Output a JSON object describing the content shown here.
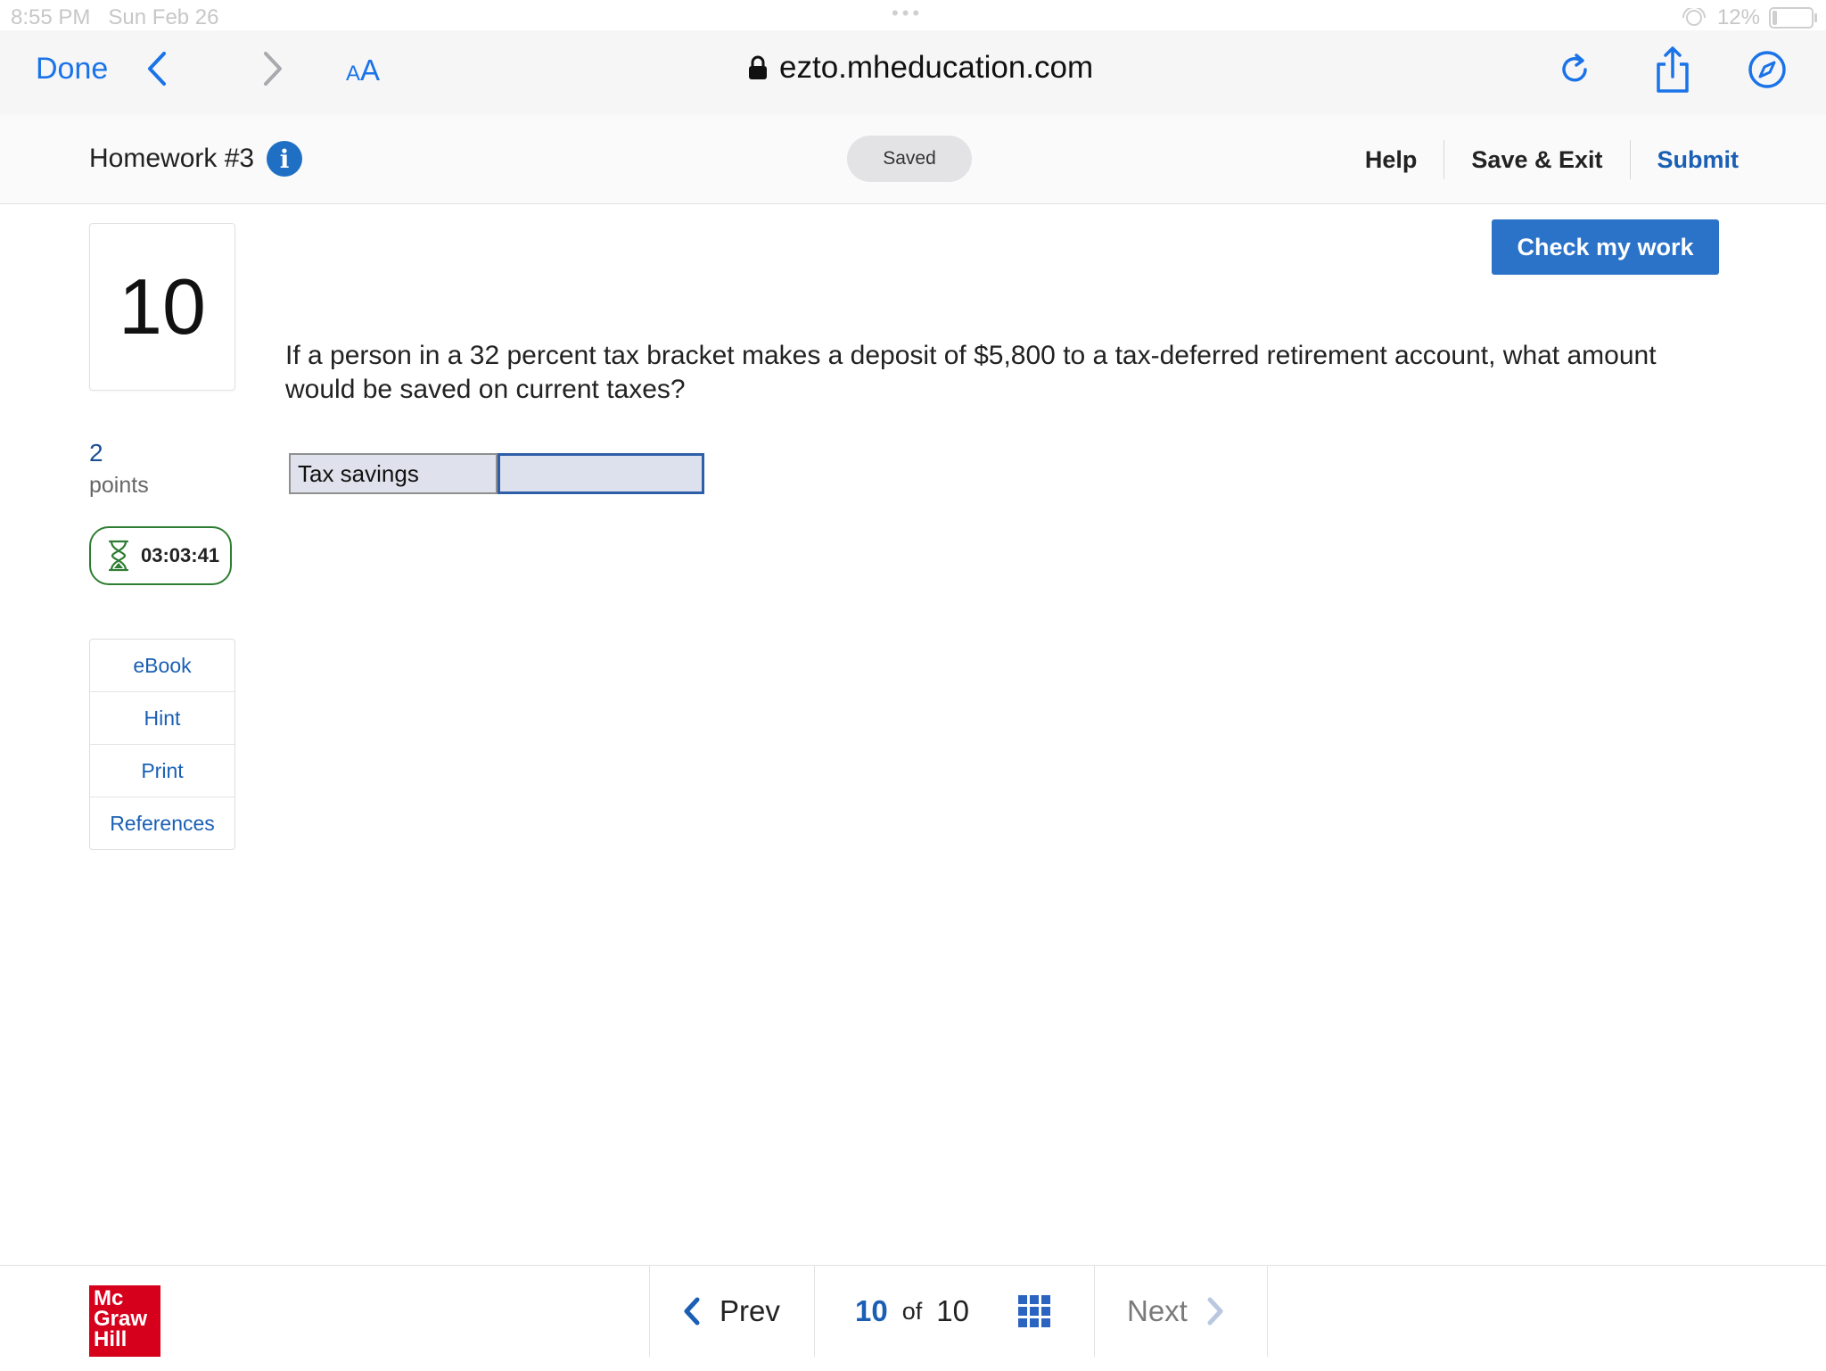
{
  "status_bar": {
    "time": "8:55 PM",
    "date": "Sun Feb 26",
    "battery": "12%"
  },
  "browser": {
    "done_label": "Done",
    "text_size_small": "A",
    "text_size_large": "A",
    "url": "ezto.mheducation.com"
  },
  "header": {
    "assignment_title": "Homework #3",
    "info_icon": "i",
    "save_status": "Saved",
    "help_label": "Help",
    "save_exit_label": "Save & Exit",
    "submit_label": "Submit"
  },
  "check_button_label": "Check my work",
  "sidebar": {
    "question_number": "10",
    "points_value": "2",
    "points_label": "points",
    "timer": "03:03:41",
    "tools": [
      {
        "label": "eBook"
      },
      {
        "label": "Hint"
      },
      {
        "label": "Print"
      },
      {
        "label": "References"
      }
    ]
  },
  "question": {
    "text": "If a person in a 32 percent tax bracket makes a deposit of $5,800 to a tax-deferred retirement account, what amount would be saved on current taxes?",
    "answer_label": "Tax savings",
    "answer_value": ""
  },
  "footer": {
    "logo_line1": "Mc",
    "logo_line2": "Graw",
    "logo_line3": "Hill",
    "prev_label": "Prev",
    "current_page": "10",
    "of_label": "of",
    "total_pages": "10",
    "next_label": "Next"
  },
  "colors": {
    "accent": "#1a73e8",
    "primary_button": "#2b73c8",
    "timer_border": "#2e7d32",
    "logo": "#d6001c"
  }
}
